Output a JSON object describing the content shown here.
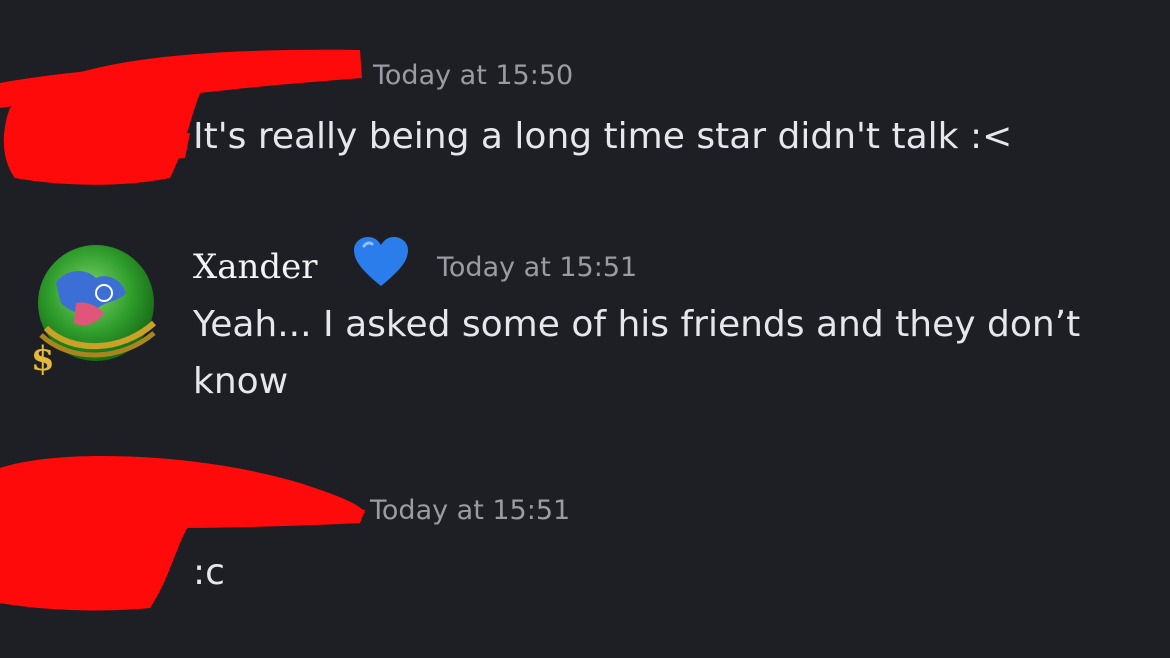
{
  "colors": {
    "background": "#1e1f24",
    "message_text": "#e6e7ea",
    "timestamp": "#9a9ca3",
    "username": "#f2f3f5",
    "redaction": "#ff0a0a",
    "heart_badge": "#2a7dea"
  },
  "messages": [
    {
      "author": "",
      "timestamp": "Today at 15:50",
      "text": "It's really being a long time star didn't talk :<",
      "redacted": true
    },
    {
      "author": "Xander",
      "badge_icon": "blue-heart-icon",
      "timestamp": "Today at 15:51",
      "text": "Yeah... I asked some of his friends and they don’t know",
      "redacted": false
    },
    {
      "author": "",
      "timestamp": "Today at 15:51",
      "text": ":c",
      "redacted": true
    }
  ]
}
